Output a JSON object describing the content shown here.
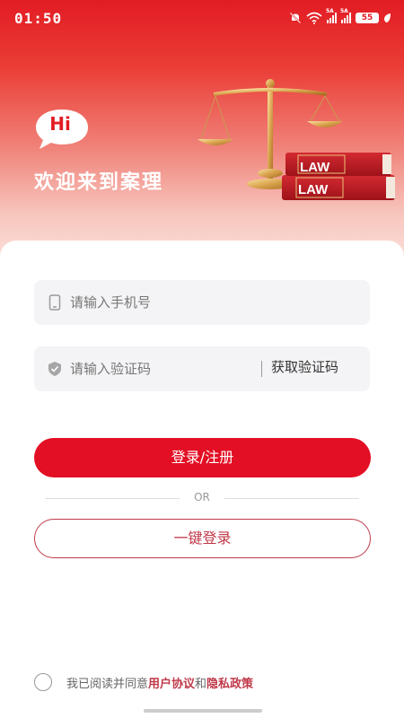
{
  "status_bar": {
    "time": "01:50",
    "network_tag": "5A",
    "battery": "55",
    "icons": [
      "mute-bell-icon",
      "wifi-icon",
      "signal-icon",
      "signal-icon",
      "battery-icon",
      "leaf-icon"
    ]
  },
  "header": {
    "hi_badge": "Hi",
    "welcome": "欢迎来到案理",
    "book_label": "LAW",
    "illustration": "scales-and-law-books"
  },
  "form": {
    "phone_placeholder": "请输入手机号",
    "code_placeholder": "请输入验证码",
    "get_code_label": "获取验证码"
  },
  "actions": {
    "login_label": "登录/注册",
    "or_label": "OR",
    "one_click_label": "一键登录"
  },
  "agreement": {
    "prefix": "我已阅读并同意",
    "user_agreement": "用户协议",
    "and": "和",
    "privacy_policy": "隐私政策"
  },
  "colors": {
    "brand_red": "#e30f24",
    "link_red": "#c0394a",
    "field_bg": "#f4f4f6"
  }
}
